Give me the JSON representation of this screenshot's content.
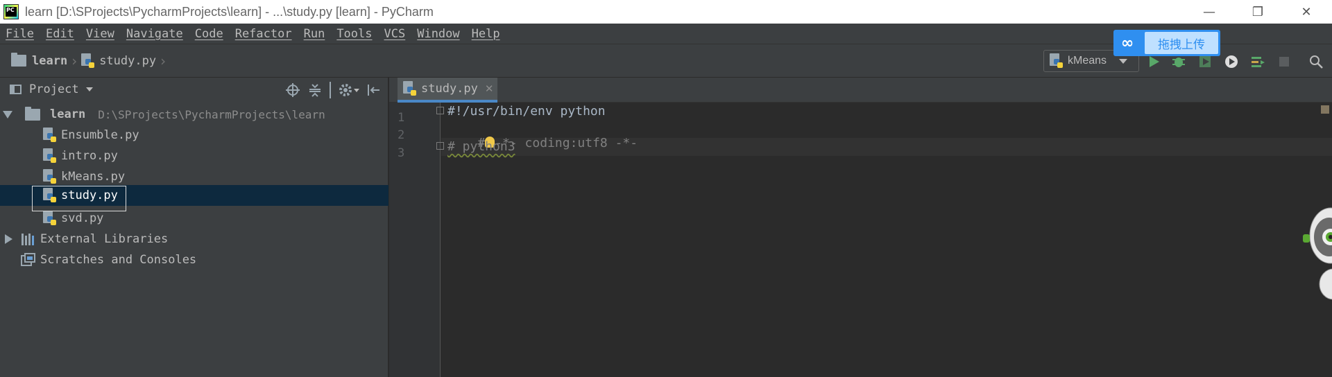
{
  "window": {
    "logo_text": "PC",
    "title": "learn [D:\\SProjects\\PycharmProjects\\learn] - ...\\study.py [learn] - PyCharm",
    "minimize_glyph": "—",
    "maximize_glyph": "❐",
    "close_glyph": "✕"
  },
  "menu": {
    "items": [
      "File",
      "Edit",
      "View",
      "Navigate",
      "Code",
      "Refactor",
      "Run",
      "Tools",
      "VCS",
      "Window",
      "Help"
    ]
  },
  "navbar": {
    "project": "learn",
    "file": "study.py",
    "run_config": "kMeans"
  },
  "baidu": {
    "label": "拖拽上传"
  },
  "project_panel": {
    "title": "Project",
    "root": {
      "name": "learn",
      "path": "D:\\SProjects\\PycharmProjects\\learn"
    },
    "files": [
      "Ensumble.py",
      "intro.py",
      "kMeans.py",
      "study.py",
      "svd.py"
    ],
    "selected_file": "study.py",
    "external_libraries": "External Libraries",
    "scratches": "Scratches and Consoles"
  },
  "editor": {
    "tab": "study.py",
    "tab_close": "✕",
    "line_numbers": [
      "1",
      "2",
      "3"
    ],
    "lines": {
      "l1": "#!/usr/bin/env python",
      "l2_prefix": "#",
      "l2_rest": "-*- coding:utf8 -*-",
      "l3": "# python3"
    }
  },
  "colors": {
    "accent_tab_underline": "#4a88c7",
    "selection": "#0d293e",
    "run_green": "#59a869",
    "baidu_blue": "#2f8ff0"
  },
  "icons": [
    "folder-icon",
    "python-file-icon",
    "run-icon",
    "debug-icon",
    "coverage-icon",
    "profile-icon",
    "build-icon",
    "stop-icon",
    "search-icon",
    "target-icon",
    "collapse-icon",
    "gear-icon",
    "hide-icon",
    "library-icon",
    "scratch-icon",
    "lightbulb-icon"
  ]
}
